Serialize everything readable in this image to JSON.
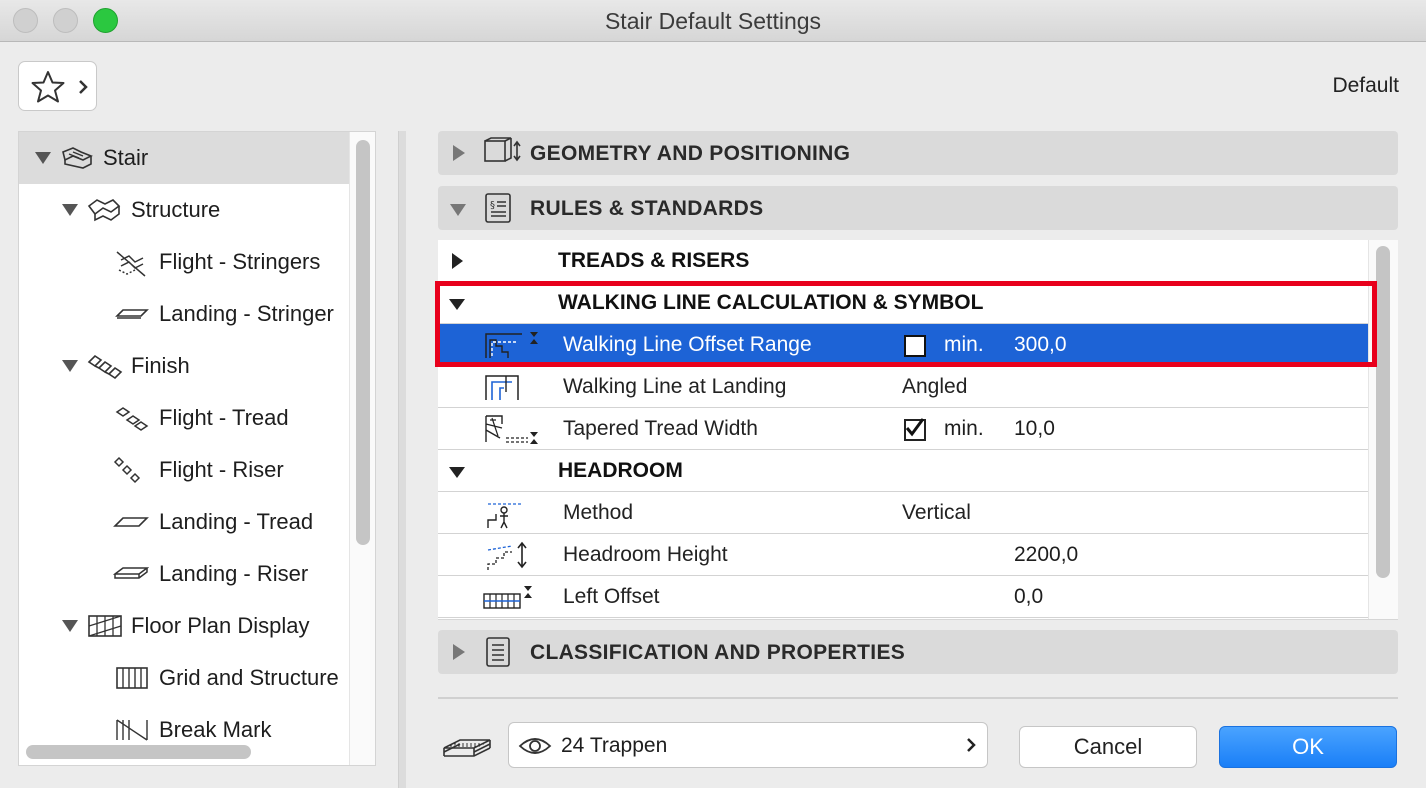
{
  "window": {
    "title": "Stair Default Settings"
  },
  "header": {
    "favorites_icon": "star-icon",
    "default_label": "Default"
  },
  "tree": {
    "items": [
      {
        "label": "Stair",
        "icon": "stair-icon"
      },
      {
        "label": "Structure",
        "icon": "structure-icon"
      },
      {
        "label": "Flight - Stringers",
        "icon": "flight-stringers-icon"
      },
      {
        "label": "Landing - Stringer",
        "icon": "landing-stringer-icon"
      },
      {
        "label": "Finish",
        "icon": "finish-icon"
      },
      {
        "label": "Flight - Tread",
        "icon": "flight-tread-icon"
      },
      {
        "label": "Flight - Riser",
        "icon": "flight-riser-icon"
      },
      {
        "label": "Landing - Tread",
        "icon": "landing-tread-icon"
      },
      {
        "label": "Landing - Riser",
        "icon": "landing-riser-icon"
      },
      {
        "label": "Floor Plan Display",
        "icon": "floor-plan-display-icon"
      },
      {
        "label": "Grid and Structure",
        "icon": "grid-structure-icon"
      },
      {
        "label": "Break Mark",
        "icon": "break-mark-icon"
      }
    ]
  },
  "sections": {
    "geometry": "GEOMETRY AND POSITIONING",
    "rules": "RULES & STANDARDS",
    "classification": "CLASSIFICATION AND PROPERTIES"
  },
  "rules": {
    "treads": "TREADS & RISERS",
    "walking": "WALKING LINE CALCULATION & SYMBOL",
    "walking_rows": [
      {
        "name": "Walking Line Offset Range",
        "checked": false,
        "min": "min.",
        "value": "300,0"
      },
      {
        "name": "Walking Line at Landing",
        "value": "Angled"
      },
      {
        "name": "Tapered Tread Width",
        "checked": true,
        "min": "min.",
        "value": "10,0"
      }
    ],
    "headroom": "HEADROOM",
    "headroom_rows": [
      {
        "name": "Method",
        "value": "Vertical"
      },
      {
        "name": "Headroom Height",
        "value": "2200,0"
      },
      {
        "name": "Left Offset",
        "value": "0,0"
      }
    ]
  },
  "footer": {
    "layer_label": "24 Trappen",
    "cancel": "Cancel",
    "ok": "OK"
  },
  "colors": {
    "selection": "#1d63d6",
    "ok_button": "#1a7ff7",
    "highlight_box": "#e8001c"
  }
}
